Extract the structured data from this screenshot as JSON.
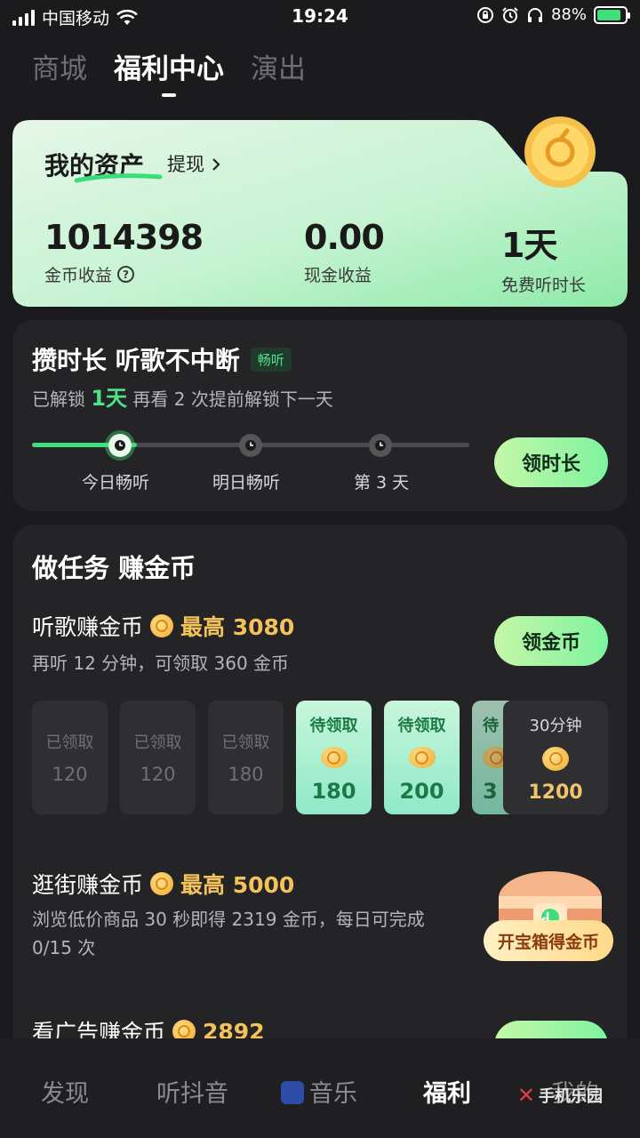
{
  "status_bar": {
    "carrier": "中国移动",
    "time": "19:24",
    "battery": "88%",
    "battery_level": 0.88,
    "icons": [
      "signal-icon",
      "wifi-icon",
      "lock-rotation-icon",
      "alarm-icon",
      "headphones-icon",
      "battery-icon"
    ]
  },
  "top_tabs": [
    {
      "label": "商城",
      "active": false
    },
    {
      "label": "福利中心",
      "active": true
    },
    {
      "label": "演出",
      "active": false
    }
  ],
  "assets": {
    "title": "我的资产",
    "withdraw": "提现",
    "stats": [
      {
        "value": "1014398",
        "label": "金币收益"
      },
      {
        "value": "0.00",
        "label": "现金收益"
      },
      {
        "value": "1天",
        "label": "免费听时长"
      }
    ],
    "help_icon": "?"
  },
  "listen": {
    "title": "攒时长 听歌不中断",
    "tag": "畅听",
    "sub_prefix": "已解锁",
    "sub_highlight": "1天",
    "sub_suffix": "再看 2 次提前解锁下一天",
    "progress_fraction": 0.24,
    "milestones": [
      "今日畅听",
      "明日畅听",
      "第 3 天"
    ],
    "button": "领时长"
  },
  "tasks": {
    "heading": "做任务 赚金币",
    "music": {
      "title": "听歌赚金币",
      "max": "最高 3080",
      "sub": "再听 12 分钟，可领取 360 金币",
      "button": "领金币",
      "slots": [
        {
          "status": "已领取",
          "value": "120"
        },
        {
          "status": "已领取",
          "value": "120"
        },
        {
          "status": "已领取",
          "value": "180"
        },
        {
          "status": "待领取",
          "value": "180"
        },
        {
          "status": "待领取",
          "value": "200"
        },
        {
          "status": "待",
          "value": "3"
        },
        {
          "status": "30分钟",
          "value": "1200"
        }
      ]
    },
    "shop": {
      "title": "逛街赚金币",
      "max": "最高 5000",
      "sub_line1": "浏览低价商品 30 秒即得 2319 金币，每日可完成",
      "sub_line2": "0/15 次",
      "chest_label": "开宝箱得金币"
    },
    "ads": {
      "title": "看广告赚金币",
      "max": "2892"
    }
  },
  "bottom_nav": [
    {
      "label": "发现",
      "active": false
    },
    {
      "label": "听抖音",
      "active": false
    },
    {
      "label": "音乐",
      "active": false
    },
    {
      "label": "福利",
      "active": true
    },
    {
      "label": "我的",
      "active": false
    }
  ],
  "watermark": "手机乐园"
}
